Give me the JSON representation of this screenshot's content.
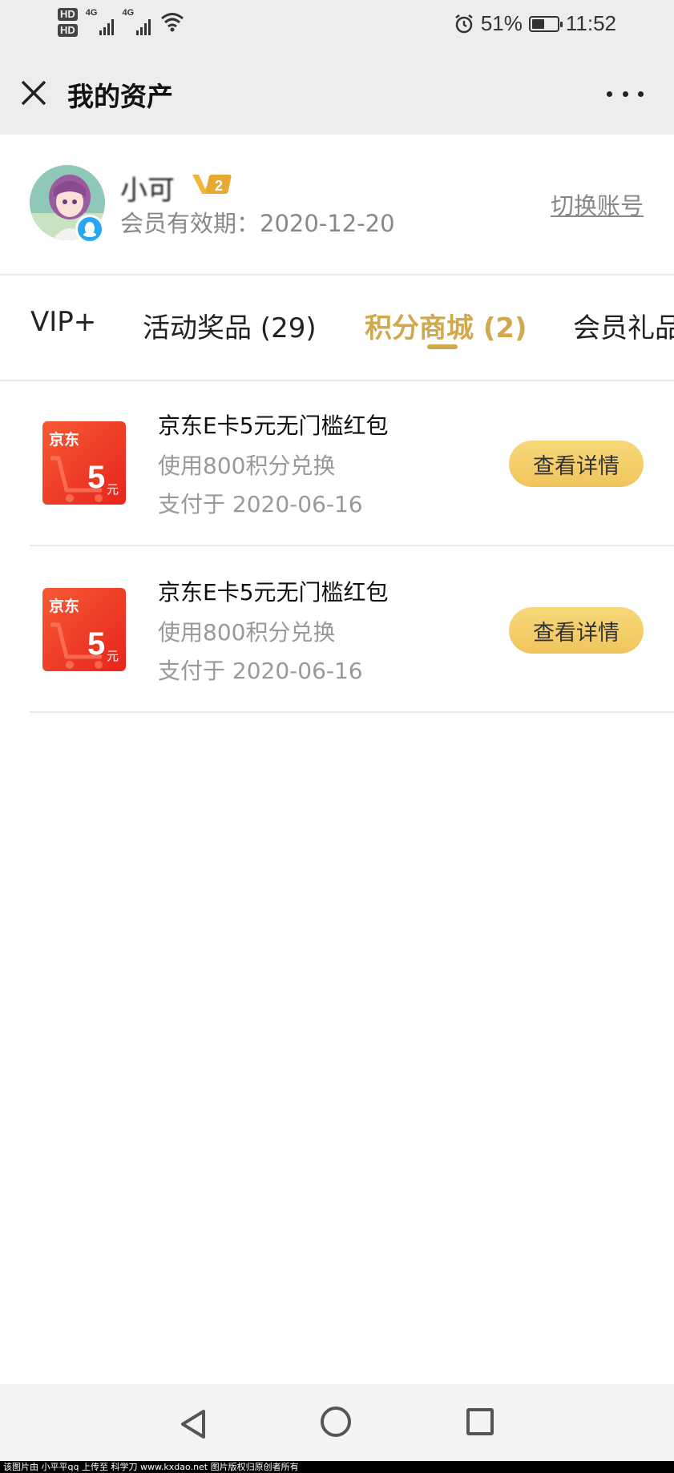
{
  "status_bar": {
    "network_1": "4G",
    "network_2": "4G",
    "battery_percent": "51%",
    "battery_level": 0.51,
    "time": "11:52",
    "icons": [
      "hd-icon",
      "signal-icon",
      "wifi-icon",
      "alarm-icon",
      "battery-icon"
    ]
  },
  "header": {
    "title": "我的资产",
    "close_icon": "close-icon",
    "more_icon": "more-icon"
  },
  "profile": {
    "username": "小可",
    "vip_level": "2",
    "expiry": "会员有效期：2020-12-20",
    "switch_account": "切换账号"
  },
  "tabs": [
    {
      "label": "VIP+",
      "active": false
    },
    {
      "label": "活动奖品 (29)",
      "active": false
    },
    {
      "label": "积分商城 (2)",
      "active": true
    },
    {
      "label": "会员礼品",
      "active": false
    }
  ],
  "items": [
    {
      "card_brand": "京东",
      "card_amount": "5",
      "card_unit": "元",
      "title": "京东E卡5元无门槛红包",
      "subtitle": "使用800积分兑换",
      "date": "支付于 2020-06-16",
      "button": "查看详情"
    },
    {
      "card_brand": "京东",
      "card_amount": "5",
      "card_unit": "元",
      "title": "京东E卡5元无门槛红包",
      "subtitle": "使用800积分兑换",
      "date": "支付于 2020-06-16",
      "button": "查看详情"
    }
  ],
  "colors": {
    "accent": "#d2a84d",
    "button": "#f3cd67",
    "card_red": "#e8241d"
  },
  "watermark": "该图片由 小平平qq 上传至 科学刀 www.kxdao.net 图片版权归原创者所有"
}
